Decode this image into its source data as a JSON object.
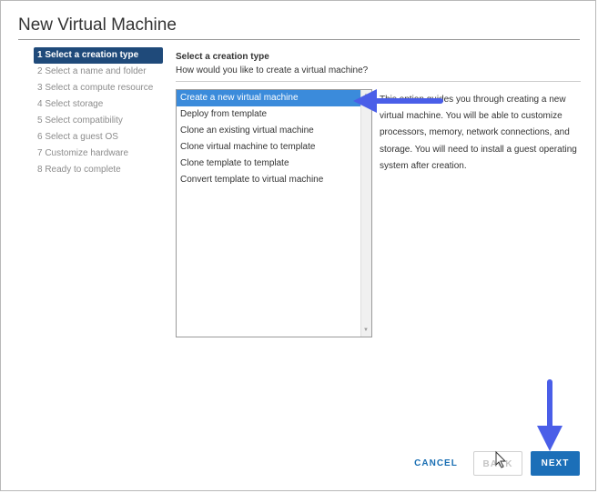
{
  "dialog": {
    "title": "New Virtual Machine"
  },
  "steps": [
    {
      "label": "1 Select a creation type",
      "active": true
    },
    {
      "label": "2 Select a name and folder",
      "active": false
    },
    {
      "label": "3 Select a compute resource",
      "active": false
    },
    {
      "label": "4 Select storage",
      "active": false
    },
    {
      "label": "5 Select compatibility",
      "active": false
    },
    {
      "label": "6 Select a guest OS",
      "active": false
    },
    {
      "label": "7 Customize hardware",
      "active": false
    },
    {
      "label": "8 Ready to complete",
      "active": false
    }
  ],
  "content": {
    "heading": "Select a creation type",
    "question": "How would you like to create a virtual machine?",
    "options": [
      {
        "label": "Create a new virtual machine",
        "selected": true
      },
      {
        "label": "Deploy from template",
        "selected": false
      },
      {
        "label": "Clone an existing virtual machine",
        "selected": false
      },
      {
        "label": "Clone virtual machine to template",
        "selected": false
      },
      {
        "label": "Clone template to template",
        "selected": false
      },
      {
        "label": "Convert template to virtual machine",
        "selected": false
      }
    ],
    "description": "This option guides you through creating a new virtual machine. You will be able to customize processors, memory, network connections, and storage. You will need to install a guest operating system after creation."
  },
  "footer": {
    "cancel_label": "CANCEL",
    "back_label": "BACK",
    "next_label": "NEXT"
  },
  "colors": {
    "active_step_bg": "#1f4a7a",
    "selected_option_bg": "#3b8bdb",
    "next_button_bg": "#1c6fb8",
    "annotation_arrow": "#4a5ee8"
  },
  "icons": {
    "scroll_up": "triangle-up-icon",
    "scroll_down": "triangle-down-icon",
    "cursor": "mouse-pointer-icon",
    "annotation": "arrow-annotation-icon"
  }
}
